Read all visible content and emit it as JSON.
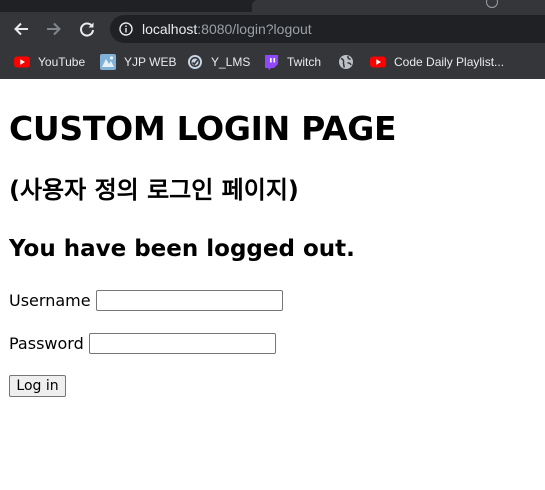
{
  "browser": {
    "url_host": "localhost",
    "url_rest": ":8080/login?logout",
    "bookmarks": [
      {
        "label": "YouTube",
        "icon": "youtube-icon"
      },
      {
        "label": "YJP WEB",
        "icon": "site-icon"
      },
      {
        "label": "Y_LMS",
        "icon": "lms-icon"
      },
      {
        "label": "Twitch",
        "icon": "twitch-icon"
      },
      {
        "label": "",
        "icon": "globe-icon"
      },
      {
        "label": "Code Daily Playlist...",
        "icon": "youtube-icon"
      }
    ]
  },
  "page": {
    "title": "CUSTOM LOGIN PAGE",
    "subtitle": "(사용자 정의 로그인 페이지)",
    "message": "You have been logged out.",
    "username_label": "Username",
    "username_value": "",
    "password_label": "Password",
    "password_value": "",
    "login_button": "Log in"
  },
  "colors": {
    "chrome": "#35363a",
    "omnibox": "#202124",
    "youtube_red": "#ff0000",
    "twitch_purple": "#9146ff"
  }
}
